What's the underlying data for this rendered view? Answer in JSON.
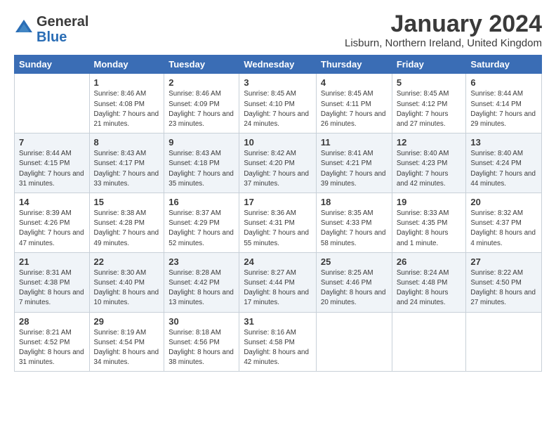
{
  "logo": {
    "general": "General",
    "blue": "Blue"
  },
  "title": "January 2024",
  "location": "Lisburn, Northern Ireland, United Kingdom",
  "days_of_week": [
    "Sunday",
    "Monday",
    "Tuesday",
    "Wednesday",
    "Thursday",
    "Friday",
    "Saturday"
  ],
  "weeks": [
    [
      {
        "day": "",
        "sunrise": "",
        "sunset": "",
        "daylight": ""
      },
      {
        "day": "1",
        "sunrise": "Sunrise: 8:46 AM",
        "sunset": "Sunset: 4:08 PM",
        "daylight": "Daylight: 7 hours and 21 minutes."
      },
      {
        "day": "2",
        "sunrise": "Sunrise: 8:46 AM",
        "sunset": "Sunset: 4:09 PM",
        "daylight": "Daylight: 7 hours and 23 minutes."
      },
      {
        "day": "3",
        "sunrise": "Sunrise: 8:45 AM",
        "sunset": "Sunset: 4:10 PM",
        "daylight": "Daylight: 7 hours and 24 minutes."
      },
      {
        "day": "4",
        "sunrise": "Sunrise: 8:45 AM",
        "sunset": "Sunset: 4:11 PM",
        "daylight": "Daylight: 7 hours and 26 minutes."
      },
      {
        "day": "5",
        "sunrise": "Sunrise: 8:45 AM",
        "sunset": "Sunset: 4:12 PM",
        "daylight": "Daylight: 7 hours and 27 minutes."
      },
      {
        "day": "6",
        "sunrise": "Sunrise: 8:44 AM",
        "sunset": "Sunset: 4:14 PM",
        "daylight": "Daylight: 7 hours and 29 minutes."
      }
    ],
    [
      {
        "day": "7",
        "sunrise": "Sunrise: 8:44 AM",
        "sunset": "Sunset: 4:15 PM",
        "daylight": "Daylight: 7 hours and 31 minutes."
      },
      {
        "day": "8",
        "sunrise": "Sunrise: 8:43 AM",
        "sunset": "Sunset: 4:17 PM",
        "daylight": "Daylight: 7 hours and 33 minutes."
      },
      {
        "day": "9",
        "sunrise": "Sunrise: 8:43 AM",
        "sunset": "Sunset: 4:18 PM",
        "daylight": "Daylight: 7 hours and 35 minutes."
      },
      {
        "day": "10",
        "sunrise": "Sunrise: 8:42 AM",
        "sunset": "Sunset: 4:20 PM",
        "daylight": "Daylight: 7 hours and 37 minutes."
      },
      {
        "day": "11",
        "sunrise": "Sunrise: 8:41 AM",
        "sunset": "Sunset: 4:21 PM",
        "daylight": "Daylight: 7 hours and 39 minutes."
      },
      {
        "day": "12",
        "sunrise": "Sunrise: 8:40 AM",
        "sunset": "Sunset: 4:23 PM",
        "daylight": "Daylight: 7 hours and 42 minutes."
      },
      {
        "day": "13",
        "sunrise": "Sunrise: 8:40 AM",
        "sunset": "Sunset: 4:24 PM",
        "daylight": "Daylight: 7 hours and 44 minutes."
      }
    ],
    [
      {
        "day": "14",
        "sunrise": "Sunrise: 8:39 AM",
        "sunset": "Sunset: 4:26 PM",
        "daylight": "Daylight: 7 hours and 47 minutes."
      },
      {
        "day": "15",
        "sunrise": "Sunrise: 8:38 AM",
        "sunset": "Sunset: 4:28 PM",
        "daylight": "Daylight: 7 hours and 49 minutes."
      },
      {
        "day": "16",
        "sunrise": "Sunrise: 8:37 AM",
        "sunset": "Sunset: 4:29 PM",
        "daylight": "Daylight: 7 hours and 52 minutes."
      },
      {
        "day": "17",
        "sunrise": "Sunrise: 8:36 AM",
        "sunset": "Sunset: 4:31 PM",
        "daylight": "Daylight: 7 hours and 55 minutes."
      },
      {
        "day": "18",
        "sunrise": "Sunrise: 8:35 AM",
        "sunset": "Sunset: 4:33 PM",
        "daylight": "Daylight: 7 hours and 58 minutes."
      },
      {
        "day": "19",
        "sunrise": "Sunrise: 8:33 AM",
        "sunset": "Sunset: 4:35 PM",
        "daylight": "Daylight: 8 hours and 1 minute."
      },
      {
        "day": "20",
        "sunrise": "Sunrise: 8:32 AM",
        "sunset": "Sunset: 4:37 PM",
        "daylight": "Daylight: 8 hours and 4 minutes."
      }
    ],
    [
      {
        "day": "21",
        "sunrise": "Sunrise: 8:31 AM",
        "sunset": "Sunset: 4:38 PM",
        "daylight": "Daylight: 8 hours and 7 minutes."
      },
      {
        "day": "22",
        "sunrise": "Sunrise: 8:30 AM",
        "sunset": "Sunset: 4:40 PM",
        "daylight": "Daylight: 8 hours and 10 minutes."
      },
      {
        "day": "23",
        "sunrise": "Sunrise: 8:28 AM",
        "sunset": "Sunset: 4:42 PM",
        "daylight": "Daylight: 8 hours and 13 minutes."
      },
      {
        "day": "24",
        "sunrise": "Sunrise: 8:27 AM",
        "sunset": "Sunset: 4:44 PM",
        "daylight": "Daylight: 8 hours and 17 minutes."
      },
      {
        "day": "25",
        "sunrise": "Sunrise: 8:25 AM",
        "sunset": "Sunset: 4:46 PM",
        "daylight": "Daylight: 8 hours and 20 minutes."
      },
      {
        "day": "26",
        "sunrise": "Sunrise: 8:24 AM",
        "sunset": "Sunset: 4:48 PM",
        "daylight": "Daylight: 8 hours and 24 minutes."
      },
      {
        "day": "27",
        "sunrise": "Sunrise: 8:22 AM",
        "sunset": "Sunset: 4:50 PM",
        "daylight": "Daylight: 8 hours and 27 minutes."
      }
    ],
    [
      {
        "day": "28",
        "sunrise": "Sunrise: 8:21 AM",
        "sunset": "Sunset: 4:52 PM",
        "daylight": "Daylight: 8 hours and 31 minutes."
      },
      {
        "day": "29",
        "sunrise": "Sunrise: 8:19 AM",
        "sunset": "Sunset: 4:54 PM",
        "daylight": "Daylight: 8 hours and 34 minutes."
      },
      {
        "day": "30",
        "sunrise": "Sunrise: 8:18 AM",
        "sunset": "Sunset: 4:56 PM",
        "daylight": "Daylight: 8 hours and 38 minutes."
      },
      {
        "day": "31",
        "sunrise": "Sunrise: 8:16 AM",
        "sunset": "Sunset: 4:58 PM",
        "daylight": "Daylight: 8 hours and 42 minutes."
      },
      {
        "day": "",
        "sunrise": "",
        "sunset": "",
        "daylight": ""
      },
      {
        "day": "",
        "sunrise": "",
        "sunset": "",
        "daylight": ""
      },
      {
        "day": "",
        "sunrise": "",
        "sunset": "",
        "daylight": ""
      }
    ]
  ]
}
